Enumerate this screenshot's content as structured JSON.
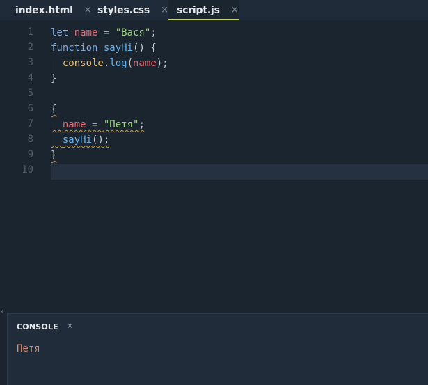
{
  "tabs": [
    {
      "label": "index.html",
      "close": "×"
    },
    {
      "label": "styles.css",
      "close": "×"
    },
    {
      "label": "script.js",
      "close": "×"
    }
  ],
  "active_tab": "script.js",
  "editor": {
    "line_numbers": [
      "1",
      "2",
      "3",
      "4",
      "5",
      "6",
      "7",
      "8",
      "9",
      "10"
    ],
    "lines": [
      [
        {
          "t": "let",
          "c": "kw"
        },
        {
          "t": " ",
          "c": "pun"
        },
        {
          "t": "name",
          "c": "var"
        },
        {
          "t": " = ",
          "c": "pun"
        },
        {
          "t": "\"Вася\"",
          "c": "str"
        },
        {
          "t": ";",
          "c": "pun"
        }
      ],
      [
        {
          "t": "function",
          "c": "kw"
        },
        {
          "t": " ",
          "c": "pun"
        },
        {
          "t": "sayHi",
          "c": "fn"
        },
        {
          "t": "() {",
          "c": "pun"
        }
      ],
      [
        {
          "t": "  ",
          "c": "pun"
        },
        {
          "t": "console",
          "c": "obj"
        },
        {
          "t": ".",
          "c": "pun"
        },
        {
          "t": "log",
          "c": "fn"
        },
        {
          "t": "(",
          "c": "pun"
        },
        {
          "t": "name",
          "c": "var"
        },
        {
          "t": ");",
          "c": "pun"
        }
      ],
      [
        {
          "t": "}",
          "c": "pun"
        }
      ],
      [],
      [
        {
          "t": "{",
          "c": "pun squig"
        }
      ],
      [
        {
          "t": "  ",
          "c": "pun squig"
        },
        {
          "t": "name",
          "c": "var squig"
        },
        {
          "t": " = ",
          "c": "pun squig"
        },
        {
          "t": "\"Петя\"",
          "c": "str squig"
        },
        {
          "t": ";",
          "c": "pun squig"
        }
      ],
      [
        {
          "t": "  ",
          "c": "pun squig"
        },
        {
          "t": "sayHi",
          "c": "fn squig"
        },
        {
          "t": "();",
          "c": "pun squig"
        }
      ],
      [
        {
          "t": "}",
          "c": "pun squig"
        }
      ],
      []
    ]
  },
  "collapse_icon": "‹",
  "console": {
    "title": "CONSOLE",
    "close": "×",
    "output": "Петя"
  },
  "colors": {
    "background": "#1b2530",
    "tab_active_underline": "#c6d36a",
    "keyword": "#7fa8d8",
    "variable": "#e06c75",
    "string": "#9ad17a",
    "function": "#61b3ef",
    "object": "#e5c07b",
    "console_output": "#d98b6e",
    "warning_squiggle": "#d79b3a"
  }
}
